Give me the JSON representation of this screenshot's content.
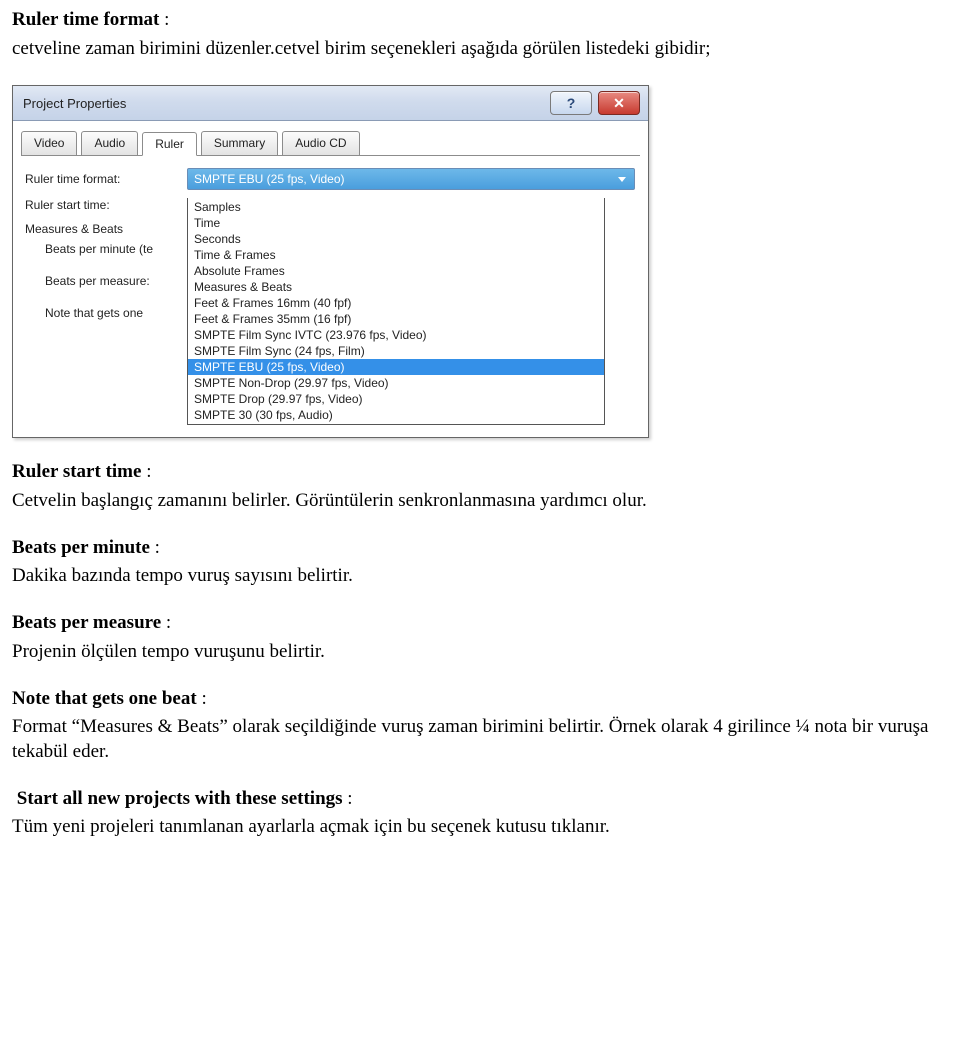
{
  "doc": {
    "p1_label": "Ruler time format",
    "p1_text": "cetveline zaman birimini düzenler.cetvel birim seçenekleri aşağıda görülen listedeki gibidir;",
    "p2_label": "Ruler start time",
    "p2_text": "Cetvelin başlangıç zamanını belirler. Görüntülerin senkronlanmasına yardımcı olur.",
    "p3_label": "Beats per minute",
    "p3_text": "Dakika bazında tempo vuruş sayısını belirtir.",
    "p4_label": "Beats per measure",
    "p4_text": "Projenin ölçülen tempo vuruşunu belirtir.",
    "p5_label": "Note that gets one beat",
    "p5_text": "Format “Measures & Beats” olarak seçildiğinde vuruş zaman birimini belirtir. Örnek olarak 4 girilince ¼ nota bir vuruşa tekabül eder.",
    "p6_label": "Start all new projects with these settings",
    "p6_text": "Tüm yeni projeleri tanımlanan ayarlarla açmak için bu seçenek kutusu tıklanır."
  },
  "dialog": {
    "title": "Project Properties",
    "tabs": {
      "video": "Video",
      "audio": "Audio",
      "ruler": "Ruler",
      "summary": "Summary",
      "audiocd": "Audio CD"
    },
    "labels": {
      "ruler_time_format": "Ruler time format:",
      "ruler_start_time": "Ruler start time:",
      "measures_beats": "Measures & Beats",
      "bpm": "Beats per minute (te",
      "bpmeasure": "Beats per measure:",
      "note_one_beat": "Note that gets one"
    },
    "combo_selected": "SMPTE EBU (25 fps, Video)",
    "options": {
      "o0": "Samples",
      "o1": "Time",
      "o2": "Seconds",
      "o3": "Time & Frames",
      "o4": "Absolute Frames",
      "o5": "Measures & Beats",
      "o6": "Feet & Frames 16mm (40 fpf)",
      "o7": "Feet & Frames 35mm (16 fpf)",
      "o8": "SMPTE Film Sync IVTC (23.976 fps, Video)",
      "o9": "SMPTE Film Sync (24 fps, Film)",
      "o10": "SMPTE EBU (25 fps, Video)",
      "o11": "SMPTE Non-Drop (29.97 fps, Video)",
      "o12": "SMPTE Drop (29.97 fps, Video)",
      "o13": "SMPTE 30 (30 fps, Audio)"
    }
  }
}
